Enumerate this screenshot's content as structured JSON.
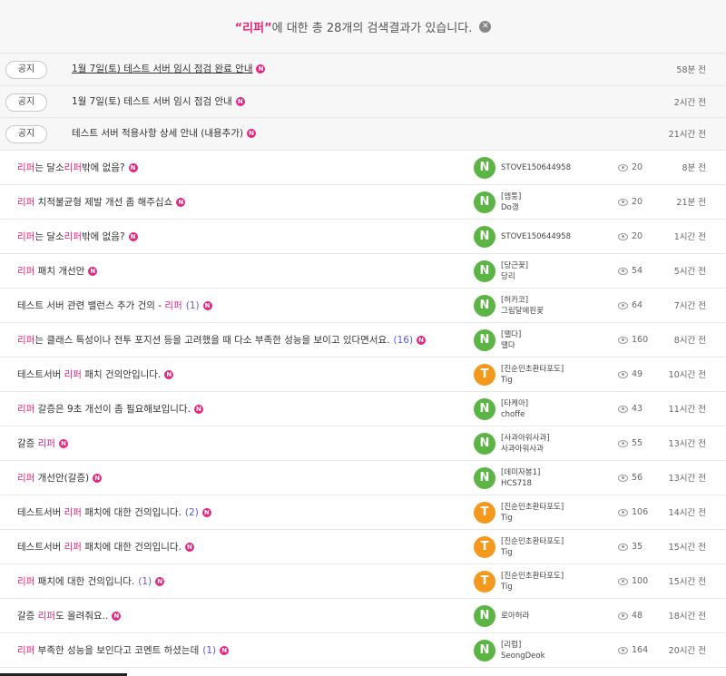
{
  "search_summary": {
    "quote_open": "“",
    "keyword": "리퍼",
    "quote_close": "”",
    "text": "에 대한 총 28개의 검색결과가 있습니다.",
    "clear_glyph": "✕"
  },
  "new_badge": "N",
  "notices": [
    {
      "label": "공지",
      "title": "1월 7일(토) 테스트 서버 임시 점검 완료 안내",
      "time": "58분 전",
      "underlined": true
    },
    {
      "label": "공지",
      "title": "1월 7일(토) 테스트 서버 임시 점검 안내",
      "time": "2시간 전",
      "underlined": false
    },
    {
      "label": "공지",
      "title": "테스트 서버 적용사항 상세 안내 (내용추가)",
      "time": "21시간 전",
      "underlined": false
    }
  ],
  "posts": [
    {
      "parts": [
        {
          "t": "리퍼",
          "hl": true
        },
        {
          "t": "는 달소",
          "hl": false
        },
        {
          "t": "리퍼",
          "hl": true
        },
        {
          "t": "밖에 없음?",
          "hl": false
        }
      ],
      "comments": "",
      "avatar": "N",
      "avatar_color": "green",
      "author_tag": "",
      "author": "STOVE150644958",
      "views": "20",
      "time": "8분 전"
    },
    {
      "parts": [
        {
          "t": "리퍼",
          "hl": true
        },
        {
          "t": " 치적불균형 제발 개선 좀 해주십쇼",
          "hl": false
        }
      ],
      "comments": "",
      "avatar": "N",
      "avatar_color": "green",
      "author_tag": "[엠퉁]",
      "author": "Do갱",
      "views": "20",
      "time": "21분 전"
    },
    {
      "parts": [
        {
          "t": "리퍼",
          "hl": true
        },
        {
          "t": "는 달소",
          "hl": false
        },
        {
          "t": "리퍼",
          "hl": true
        },
        {
          "t": "밖에 없음?",
          "hl": false
        }
      ],
      "comments": "",
      "avatar": "N",
      "avatar_color": "green",
      "author_tag": "",
      "author": "STOVE150644958",
      "views": "20",
      "time": "1시간 전"
    },
    {
      "parts": [
        {
          "t": "리퍼",
          "hl": true
        },
        {
          "t": " 패치 개선안",
          "hl": false
        }
      ],
      "comments": "",
      "avatar": "N",
      "avatar_color": "green",
      "author_tag": "[당근꽃]",
      "author": "당리",
      "views": "54",
      "time": "5시간 전"
    },
    {
      "parts": [
        {
          "t": "테스트 서버 관련 밸런스 추가 건의 - ",
          "hl": false
        },
        {
          "t": "리퍼",
          "hl": true
        }
      ],
      "comments": "(1)",
      "avatar": "N",
      "avatar_color": "green",
      "author_tag": "[허카코]",
      "author": "그림달에핀꽃",
      "views": "64",
      "time": "7시간 전"
    },
    {
      "parts": [
        {
          "t": "리퍼",
          "hl": true
        },
        {
          "t": "는 클래스 특성이나 전투 포지션 등을 고려했을 때 다소 부족한 성능을 보이고 있다면서요.",
          "hl": false
        }
      ],
      "comments": "(16)",
      "avatar": "N",
      "avatar_color": "green",
      "author_tag": "[뗄다]",
      "author": "뗄다",
      "views": "160",
      "time": "8시간 전"
    },
    {
      "parts": [
        {
          "t": "테스트서버 ",
          "hl": false
        },
        {
          "t": "리퍼",
          "hl": true
        },
        {
          "t": " 패치 건의안입니다.",
          "hl": false
        }
      ],
      "comments": "",
      "avatar": "T",
      "avatar_color": "orange",
      "author_tag": "[진순민초환타포도]",
      "author": "Tig",
      "views": "49",
      "time": "10시간 전"
    },
    {
      "parts": [
        {
          "t": "리퍼",
          "hl": true
        },
        {
          "t": " 갈증은 9초 개선이 좀 필요해보입니다.",
          "hl": false
        }
      ],
      "comments": "",
      "avatar": "N",
      "avatar_color": "green",
      "author_tag": "[타케아]",
      "author": "choffe",
      "views": "43",
      "time": "11시간 전"
    },
    {
      "parts": [
        {
          "t": "갈증 ",
          "hl": false
        },
        {
          "t": "리퍼",
          "hl": true
        }
      ],
      "comments": "",
      "avatar": "N",
      "avatar_color": "green",
      "author_tag": "[사과아워사과]",
      "author": "사과아워사과",
      "views": "55",
      "time": "13시간 전"
    },
    {
      "parts": [
        {
          "t": "리퍼",
          "hl": true
        },
        {
          "t": " 개선안(갈증)",
          "hl": false
        }
      ],
      "comments": "",
      "avatar": "N",
      "avatar_color": "green",
      "author_tag": "[데미자봉1]",
      "author": "HCS718",
      "views": "56",
      "time": "13시간 전"
    },
    {
      "parts": [
        {
          "t": "테스트서버 ",
          "hl": false
        },
        {
          "t": "리퍼",
          "hl": true
        },
        {
          "t": " 패치에 대한 건의입니다.",
          "hl": false
        }
      ],
      "comments": "(2)",
      "avatar": "T",
      "avatar_color": "orange",
      "author_tag": "[진순민초환타포도]",
      "author": "Tig",
      "views": "106",
      "time": "14시간 전"
    },
    {
      "parts": [
        {
          "t": "테스트서버 ",
          "hl": false
        },
        {
          "t": "리퍼",
          "hl": true
        },
        {
          "t": " 패치에 대한 건의입니다.",
          "hl": false
        }
      ],
      "comments": "",
      "avatar": "T",
      "avatar_color": "orange",
      "author_tag": "[진순민초환타포도]",
      "author": "Tig",
      "views": "35",
      "time": "15시간 전"
    },
    {
      "parts": [
        {
          "t": "리퍼",
          "hl": true
        },
        {
          "t": " 패치에 대한 건의입니다.",
          "hl": false
        }
      ],
      "comments": "(1)",
      "avatar": "T",
      "avatar_color": "orange",
      "author_tag": "[진순민초환타포도]",
      "author": "Tig",
      "views": "100",
      "time": "15시간 전"
    },
    {
      "parts": [
        {
          "t": "갈증 ",
          "hl": false
        },
        {
          "t": "리퍼",
          "hl": true
        },
        {
          "t": "도 올려줘요..",
          "hl": false
        }
      ],
      "comments": "",
      "avatar": "N",
      "avatar_color": "green",
      "author_tag": "",
      "author": "로아허라",
      "views": "48",
      "time": "18시간 전"
    },
    {
      "parts": [
        {
          "t": "리퍼",
          "hl": true
        },
        {
          "t": " 부족한 성능을 보인다고 코멘트 하셨는데",
          "hl": false
        }
      ],
      "comments": "(1)",
      "avatar": "N",
      "avatar_color": "green",
      "author_tag": "[리럽]",
      "author": "SeongDeok",
      "views": "164",
      "time": "20시간 전"
    }
  ]
}
